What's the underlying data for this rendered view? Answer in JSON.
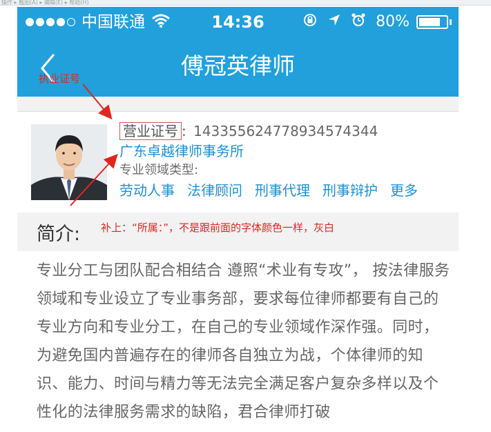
{
  "window": {
    "top_strip_text": "操作 ▸ 截图(A) ▸ 编辑(E) ▸ 帮助(H)"
  },
  "status_bar": {
    "carrier": "中国联通",
    "time": "14:36",
    "battery": "80%",
    "battery_level": 0.8,
    "icons": [
      "signal-dots-icon",
      "wifi-icon",
      "rotation-lock-icon",
      "location-arrow-icon",
      "alarm-icon",
      "battery-icon"
    ]
  },
  "nav": {
    "title": "傅冠英律师",
    "back_icon": "chevron-left-icon"
  },
  "profile": {
    "license_label": "营业证号",
    "license_sep": ":",
    "license_number": "14335562477893457434 4",
    "firm": "广东卓越律师事务所",
    "field_label": "专业领域类型:",
    "tags": [
      "劳动人事",
      "法律顾问",
      "刑事代理",
      "刑事辩护",
      "更多"
    ]
  },
  "intro": {
    "title": "简介:",
    "text": "专业分工与团队配合相结合 遵照“术业有专攻”， 按法律服务领域和专业设立了专业事务部，要求每位律师都要有自己的专业方向和专业分工，在自己的专业领域作深作强。同时，为避免国内普遍存在的律师各自独立为战，个体律师的知识、能力、时间与精力等无法完全满足客户复杂多样以及个性化的法律服务需求的缺陷，君合律师打破"
  },
  "annotations": {
    "note_license": "执业证号",
    "note_affiliation": "补上：“所属：”，不是跟前面的字体颜色一样，灰白",
    "color": "#e0261e"
  }
}
